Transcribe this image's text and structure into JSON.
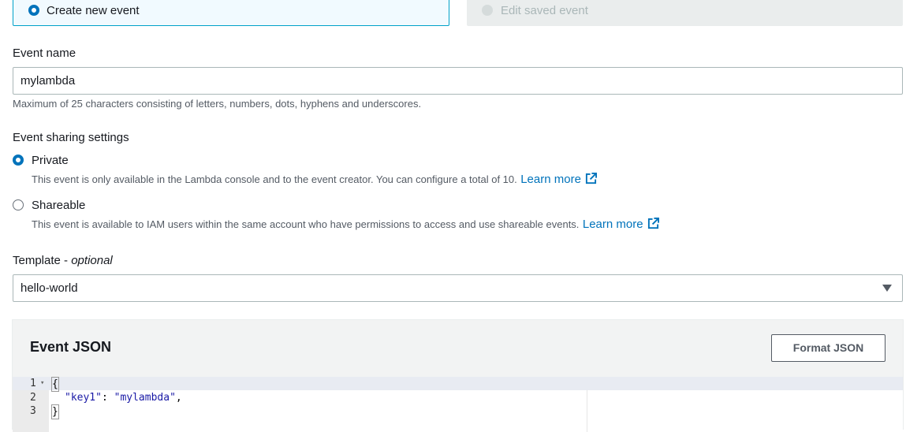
{
  "event_mode": {
    "create_label": "Create new event",
    "edit_label": "Edit saved event"
  },
  "event_name": {
    "label": "Event name",
    "value": "mylambda",
    "hint": "Maximum of 25 characters consisting of letters, numbers, dots, hyphens and underscores."
  },
  "sharing": {
    "label": "Event sharing settings",
    "private": {
      "label": "Private",
      "description": "This event is only available in the Lambda console and to the event creator. You can configure a total of 10.",
      "link": "Learn more"
    },
    "shareable": {
      "label": "Shareable",
      "description": "This event is available to IAM users within the same account who have permissions to access and use shareable events.",
      "link": "Learn more"
    }
  },
  "template": {
    "label": "Template",
    "optional": "optional",
    "selected": "hello-world"
  },
  "event_json": {
    "title": "Event JSON",
    "format_button": "Format JSON",
    "lines": [
      {
        "number": "1",
        "text": "{"
      },
      {
        "number": "2",
        "key": "\"key1\"",
        "sep": ": ",
        "value": "\"mylambda\"",
        "end": ","
      },
      {
        "number": "3",
        "text": "}"
      }
    ]
  },
  "colors": {
    "accent": "#0073bb",
    "selected_tile_bg": "#f1faff",
    "selected_tile_border": "#00a1c9"
  }
}
